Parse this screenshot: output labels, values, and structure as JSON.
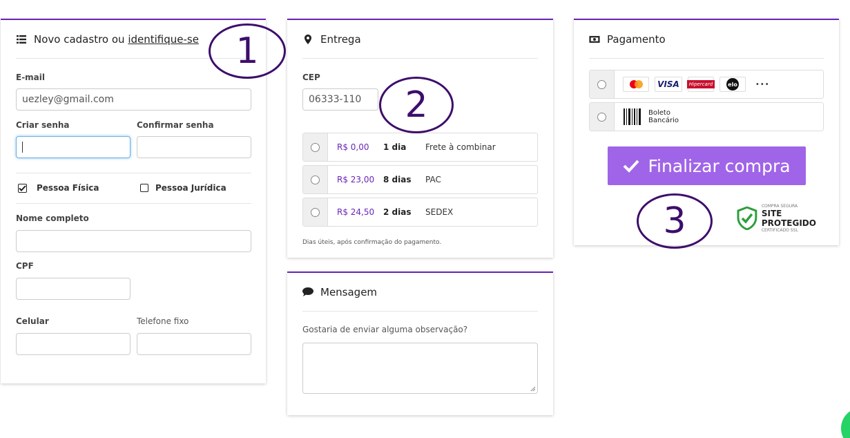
{
  "cadastro": {
    "title_prefix": "Novo cadastro ou ",
    "title_link": "identifique-se",
    "email_label": "E-mail",
    "email_value": "uezley@gmail.com",
    "senha_label": "Criar senha",
    "confirmar_label": "Confirmar senha",
    "pf_label": "Pessoa Física",
    "pj_label": "Pessoa Jurídica",
    "nome_label": "Nome completo",
    "cpf_label": "CPF",
    "celular_label": "Celular",
    "telefone_label": "Telefone fixo"
  },
  "entrega": {
    "title": "Entrega",
    "cep_label": "CEP",
    "cep_value": "06333-110",
    "options": [
      {
        "price": "R$ 0,00",
        "days": "1 dia",
        "name": "Frete à combinar"
      },
      {
        "price": "R$ 23,00",
        "days": "8 dias",
        "name": "PAC"
      },
      {
        "price": "R$ 24,50",
        "days": "2 dias",
        "name": "SEDEX"
      }
    ],
    "note": "Dias úteis, após confirmação do pagamento."
  },
  "mensagem": {
    "title": "Mensagem",
    "question": "Gostaria de enviar alguma observação?"
  },
  "pagamento": {
    "title": "Pagamento",
    "visa": "VISA",
    "hipercard": "Hipercard",
    "elo": "elo",
    "more": "•••",
    "boleto_line1": "Boleto",
    "boleto_line2": "Bancário",
    "finalizar": "Finalizar compra",
    "seal_top": "COMPRA SEGURA",
    "seal_main": "SITE PROTEGIDO",
    "seal_bottom": "CERTIFICADO SSL"
  },
  "annotations": {
    "one": "1",
    "two": "2",
    "three": "3"
  },
  "colors": {
    "accent": "#6b24b8",
    "button": "#a064e8",
    "price": "#6b24b8",
    "seal": "#2e9e3e"
  }
}
